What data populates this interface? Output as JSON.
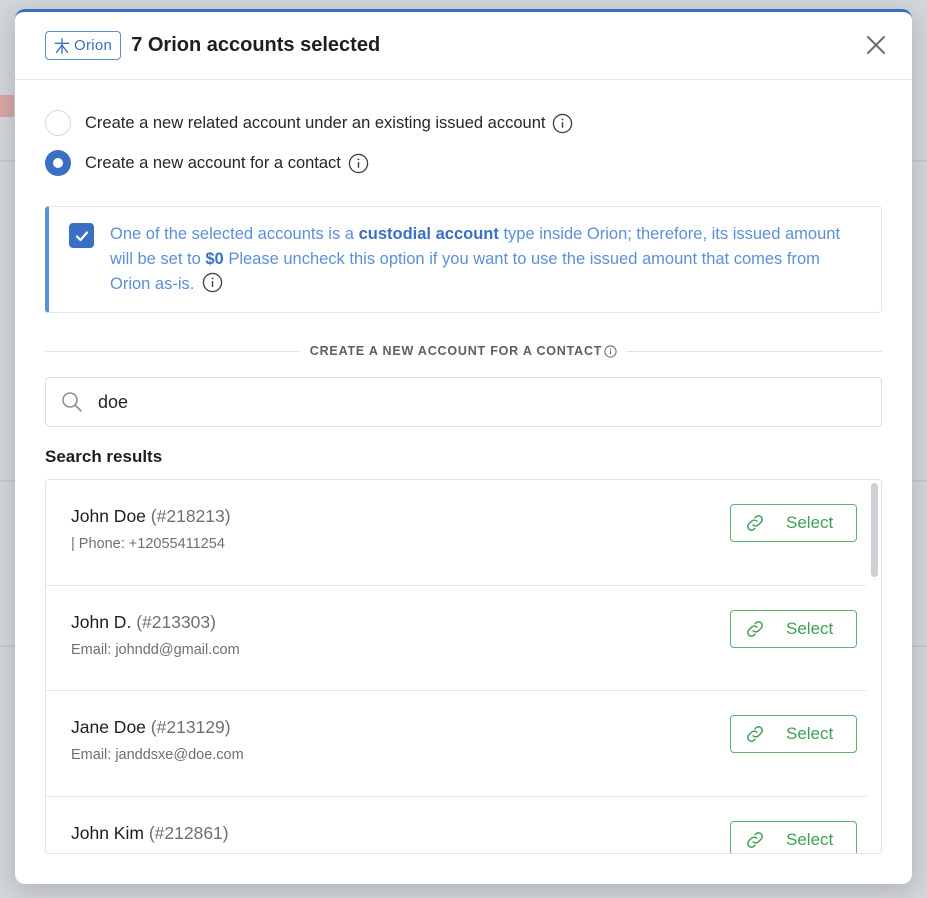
{
  "header": {
    "brand_label": "Orion",
    "title": "7 Orion accounts selected",
    "close_icon": "close-icon"
  },
  "options": [
    {
      "label": "Create a new related account under an existing issued account",
      "checked": false
    },
    {
      "label": "Create a new account for a contact",
      "checked": true
    }
  ],
  "notice": {
    "checked": true,
    "text_1": "One of the selected accounts is a ",
    "bold_1": "custodial account",
    "text_2": " type inside Orion; therefore, its issued amount will be set to ",
    "bold_2": "$0",
    "text_3": " Please uncheck this option if you want to use the issued amount that comes from Orion as-is."
  },
  "section_label": "CREATE A NEW ACCOUNT FOR A CONTACT",
  "search": {
    "value": "doe",
    "icon": "search-icon"
  },
  "results_title": "Search results",
  "results": [
    {
      "name": "John Doe",
      "id": "(#218213)",
      "detail": "| Phone: +12055411254",
      "button": "Select"
    },
    {
      "name": "John D.",
      "id": "(#213303)",
      "detail": "Email: johndd@gmail.com",
      "button": "Select"
    },
    {
      "name": "Jane Doe",
      "id": "(#213129)",
      "detail": "Email: janddsxe@doe.com",
      "button": "Select"
    },
    {
      "name": "John Kim",
      "id": "(#212861)",
      "detail": "",
      "button": "Select"
    }
  ],
  "colors": {
    "accent": "#3a6fc4",
    "notice_text": "#5c8fd8",
    "select_green": "#3f9f55"
  }
}
